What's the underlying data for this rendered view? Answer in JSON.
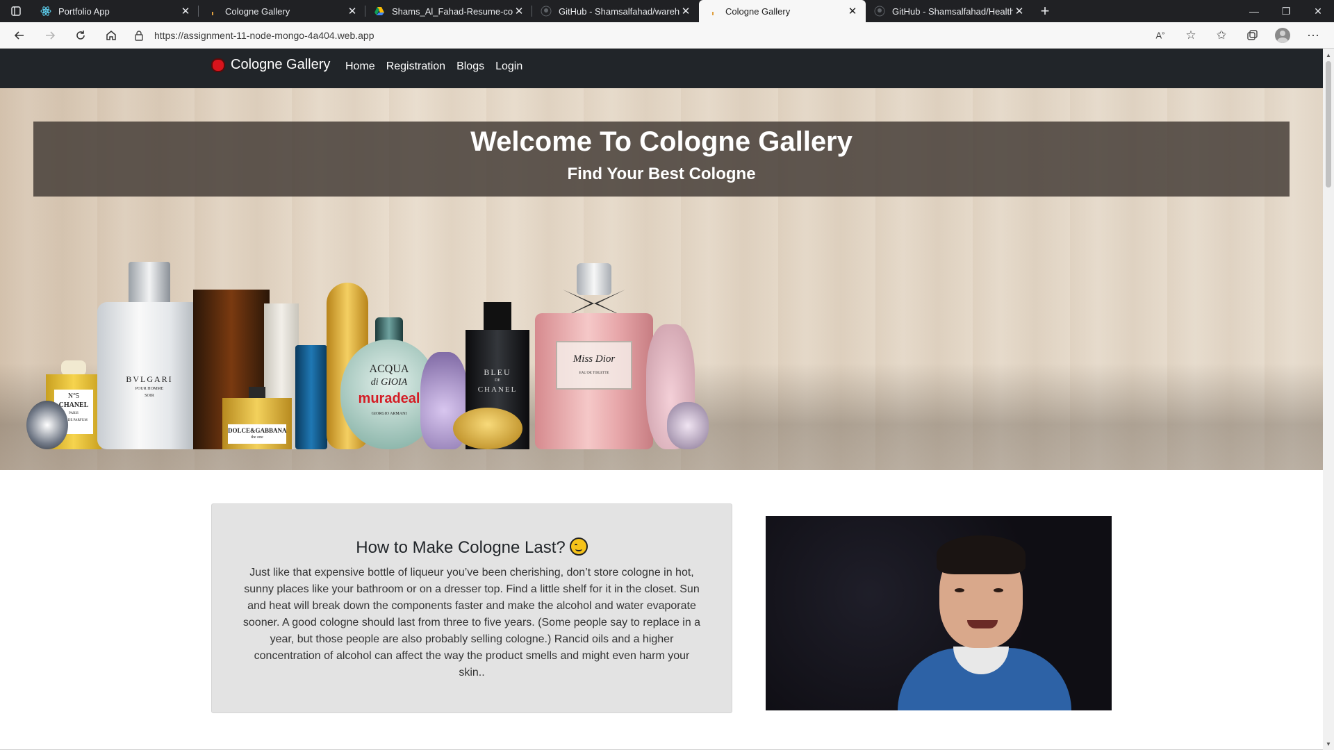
{
  "browser": {
    "tabs": [
      {
        "title": "Portfolio App",
        "icon": "react-icon",
        "active": false
      },
      {
        "title": "Cologne Gallery",
        "icon": "site-icon",
        "active": false
      },
      {
        "title": "Shams_Al_Fahad-Resume-conver",
        "icon": "drive-icon",
        "active": false
      },
      {
        "title": "GitHub - Shamsalfahad/warehou",
        "icon": "github-icon",
        "active": false
      },
      {
        "title": "Cologne Gallery",
        "icon": "site-icon",
        "active": true
      },
      {
        "title": "GitHub - Shamsalfahad/Health_C",
        "icon": "github-icon",
        "active": false
      }
    ],
    "url": "https://assignment-11-node-mongo-4a404.web.app",
    "colors": {
      "tabstrip": "#202124",
      "toolbar": "#f7f7f7"
    }
  },
  "site": {
    "brand": "Cologne Gallery",
    "nav": {
      "home": "Home",
      "registration": "Registration",
      "blogs": "Blogs",
      "login": "Login"
    },
    "hero": {
      "title": "Welcome To Cologne Gallery",
      "subtitle": "Find Your Best Cologne"
    },
    "article": {
      "heading": "How to Make Cologne Last?",
      "body": "Just like that expensive bottle of liqueur you’ve been cherishing, don’t store cologne in hot, sunny places like your bathroom or on a dresser top. Find a little shelf for it in the closet. Sun and heat will break down the components faster and make the alcohol and water evaporate sooner. A good cologne should last from three to five years. (Some people say to replace in a year, but those people are also probably selling cologne.) Rancid oils and a higher concentration of alcohol can affect the way the product smells and might even harm your skin.."
    },
    "bottle_labels": {
      "chanel_no5": "N°5",
      "chanel": "CHANEL",
      "chanel_paris": "PARIS",
      "chanel_edp": "EAU DE PARFUM",
      "bvlgari": "BVLGARI",
      "bvlgari_sub": "POUR HOMME",
      "bvlgari_soir": "SOIR",
      "dg": "DOLCE&GABBANA",
      "dg_one": "the one",
      "acqua1": "ACQUA",
      "acqua2": "di GIOIA",
      "acqua_brand": "muradeal",
      "acqua_armani": "GIORGIO ARMANI",
      "bleu": "BLEU",
      "bleu_de": "DE",
      "bleu_chanel": "CHANEL",
      "miss_dior": "Miss Dior",
      "miss_dior_sub": "EAU DE TOILETTE"
    },
    "colors": {
      "navbar": "#212529",
      "brand_logo": "#d8141c",
      "hero_band": "#463e38",
      "card_bg": "#e3e3e3"
    }
  }
}
